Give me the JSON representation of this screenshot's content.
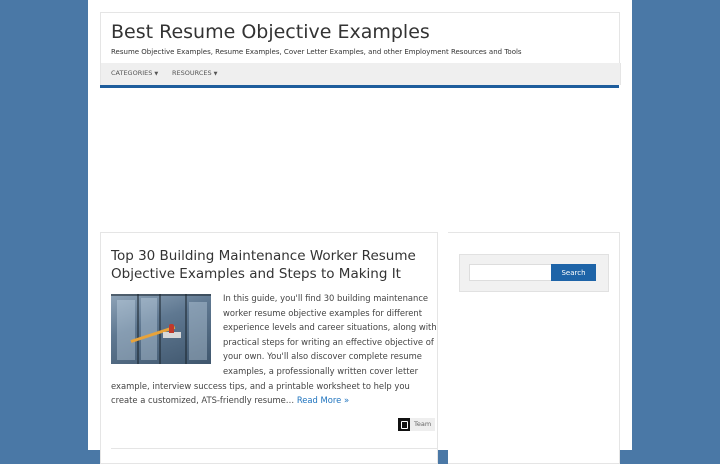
{
  "site": {
    "title": "Best Resume Objective Examples",
    "description": "Resume Objective Examples, Resume Examples, Cover Letter Examples, and other Employment Resources and Tools"
  },
  "nav": {
    "items": [
      {
        "label": "CATEGORIES"
      },
      {
        "label": "RESOURCES"
      }
    ]
  },
  "post": {
    "title": "Top 30 Building Maintenance Worker Resume Objective Examples and Steps to Making It",
    "excerpt": "In this guide, you'll find 30 building maintenance worker resume objective examples for different experience levels and career situations, along with practical steps for writing an effective objective of your own. You'll also discover complete resume examples, a professionally written cover letter example, interview success tips, and a printable worksheet to help you create a customized, ATS-friendly resume…",
    "read_more": "Read More »",
    "author": "Team"
  },
  "sidebar": {
    "search_button": "Search",
    "search_placeholder": ""
  },
  "colors": {
    "background": "#4a78a6",
    "accent": "#1e5d9c",
    "link": "#1e73be"
  }
}
